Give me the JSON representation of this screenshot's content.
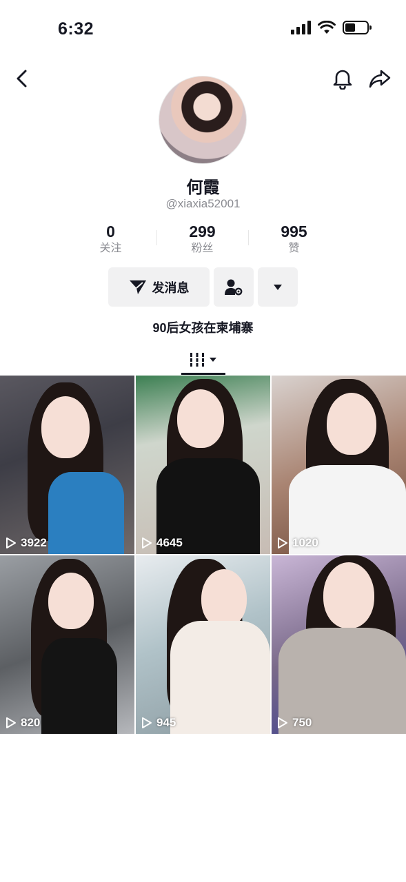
{
  "status_bar": {
    "time": "6:32"
  },
  "nav": {
    "back_icon": "chevron-left-icon",
    "bell_icon": "bell-icon",
    "share_icon": "share-arrow-icon"
  },
  "profile": {
    "name": "何霞",
    "handle": "@xiaxia52001",
    "stats": [
      {
        "value": "0",
        "label": "关注"
      },
      {
        "value": "299",
        "label": "粉丝"
      },
      {
        "value": "995",
        "label": "赞"
      }
    ],
    "message_button": "发消息",
    "bio": "90后女孩在柬埔寨"
  },
  "videos": [
    {
      "views": "3922",
      "top_color": "#2b7fc0"
    },
    {
      "views": "4645",
      "top_color": "#121212"
    },
    {
      "views": "1020",
      "top_color": "#f4f4f4"
    },
    {
      "views": "820",
      "top_color": "#141414"
    },
    {
      "views": "945",
      "top_color": "#f3ece6"
    },
    {
      "views": "750",
      "top_color": "#b9b2ad"
    }
  ]
}
